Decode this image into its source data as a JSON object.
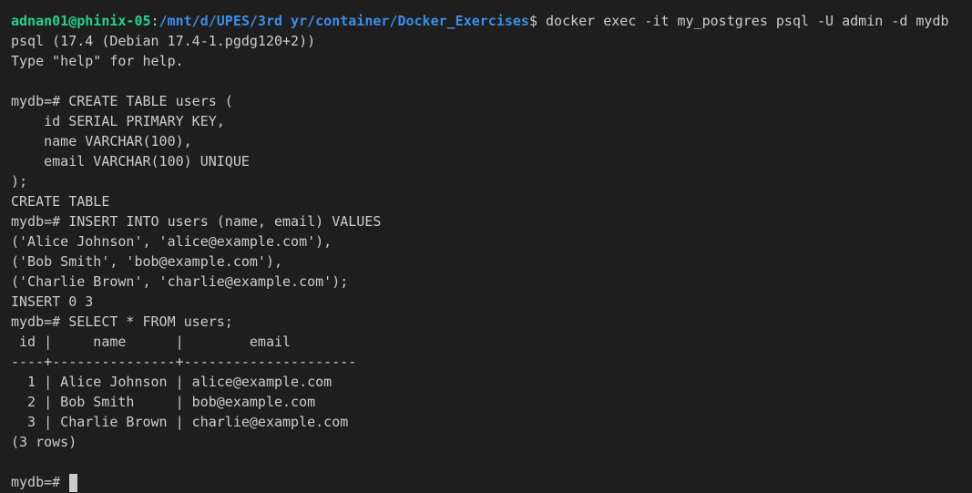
{
  "prompt": {
    "user_host": "adnan01@phinix-05",
    "colon": ":",
    "path": "/mnt/d/UPES/3rd yr/container/Docker_Exercises",
    "symbol": "$",
    "command": " docker exec -it my_postgres psql -U admin -d mydb"
  },
  "output": {
    "version": "psql (17.4 (Debian 17.4-1.pgdg120+2))",
    "help_hint": "Type \"help\" for help.",
    "create_cmd": [
      "mydb=# CREATE TABLE users (",
      "    id SERIAL PRIMARY KEY,",
      "    name VARCHAR(100),",
      "    email VARCHAR(100) UNIQUE",
      ");"
    ],
    "create_result": "CREATE TABLE",
    "insert_cmd": [
      "mydb=# INSERT INTO users (name, email) VALUES",
      "('Alice Johnson', 'alice@example.com'),",
      "('Bob Smith', 'bob@example.com'),",
      "('Charlie Brown', 'charlie@example.com');"
    ],
    "insert_result": "INSERT 0 3",
    "select_cmd": "mydb=# SELECT * FROM users;",
    "table": {
      "header": " id |     name      |        email        ",
      "separator": "----+---------------+---------------------",
      "rows": [
        "  1 | Alice Johnson | alice@example.com",
        "  2 | Bob Smith     | bob@example.com",
        "  3 | Charlie Brown | charlie@example.com"
      ],
      "row_count": "(3 rows)"
    },
    "final_prompt": "mydb=# "
  }
}
